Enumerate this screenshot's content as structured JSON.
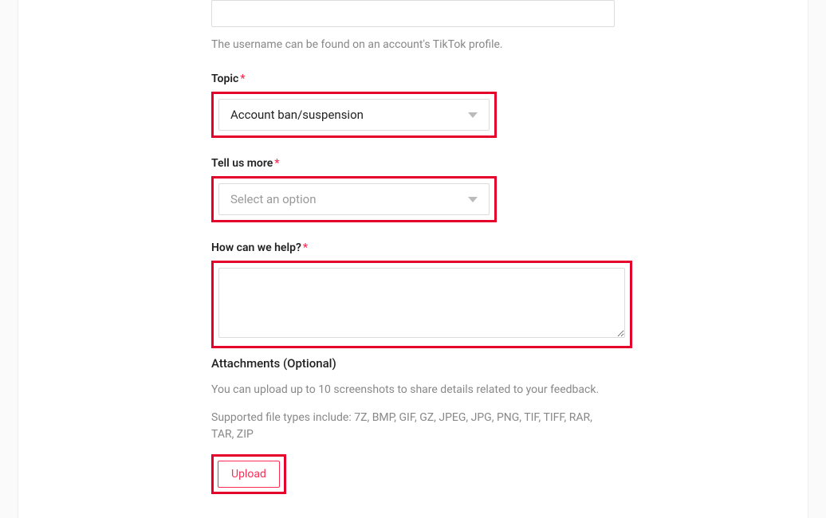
{
  "username_help": "The username can be found on an account's TikTok profile.",
  "topic": {
    "label": "Topic",
    "value": "Account ban/suspension"
  },
  "tell_us_more": {
    "label": "Tell us more",
    "placeholder": "Select an option"
  },
  "how_help": {
    "label": "How can we help?"
  },
  "attachments": {
    "heading": "Attachments (Optional)",
    "info1": "You can upload up to 10 screenshots to share details related to your feedback.",
    "info2": "Supported file types include: 7Z, BMP, GIF, GZ, JPEG, JPG, PNG, TIF, TIFF, RAR, TAR, ZIP",
    "upload_label": "Upload"
  },
  "required_marker": "*"
}
